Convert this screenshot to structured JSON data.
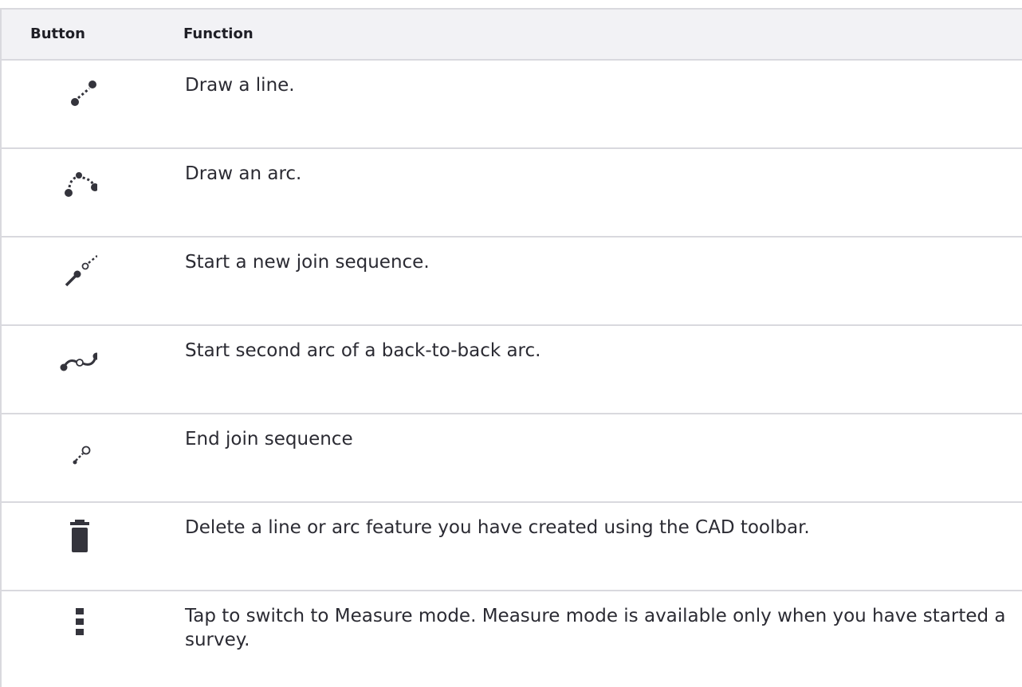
{
  "table": {
    "headers": {
      "button": "Button",
      "function": "Function"
    },
    "rows": [
      {
        "icon": "draw-line-icon",
        "function": "Draw a line."
      },
      {
        "icon": "draw-arc-icon",
        "function": "Draw an arc."
      },
      {
        "icon": "start-join-sequence-icon",
        "function": "Start a new join sequence."
      },
      {
        "icon": "back-to-back-arc-icon",
        "function": "Start second arc of a back-to-back arc."
      },
      {
        "icon": "end-join-sequence-icon",
        "function": "End join sequence"
      },
      {
        "icon": "trash-icon",
        "function": "Delete a line or arc feature you have created using the CAD toolbar."
      },
      {
        "icon": "measure-mode-icon",
        "function": "Tap to switch to Measure mode. Measure mode is available only when you have started a survey."
      }
    ]
  },
  "colors": {
    "icon": "#34343c",
    "border": "#d9d9de",
    "header_bg": "#f2f2f5",
    "text": "#2b2b33"
  }
}
